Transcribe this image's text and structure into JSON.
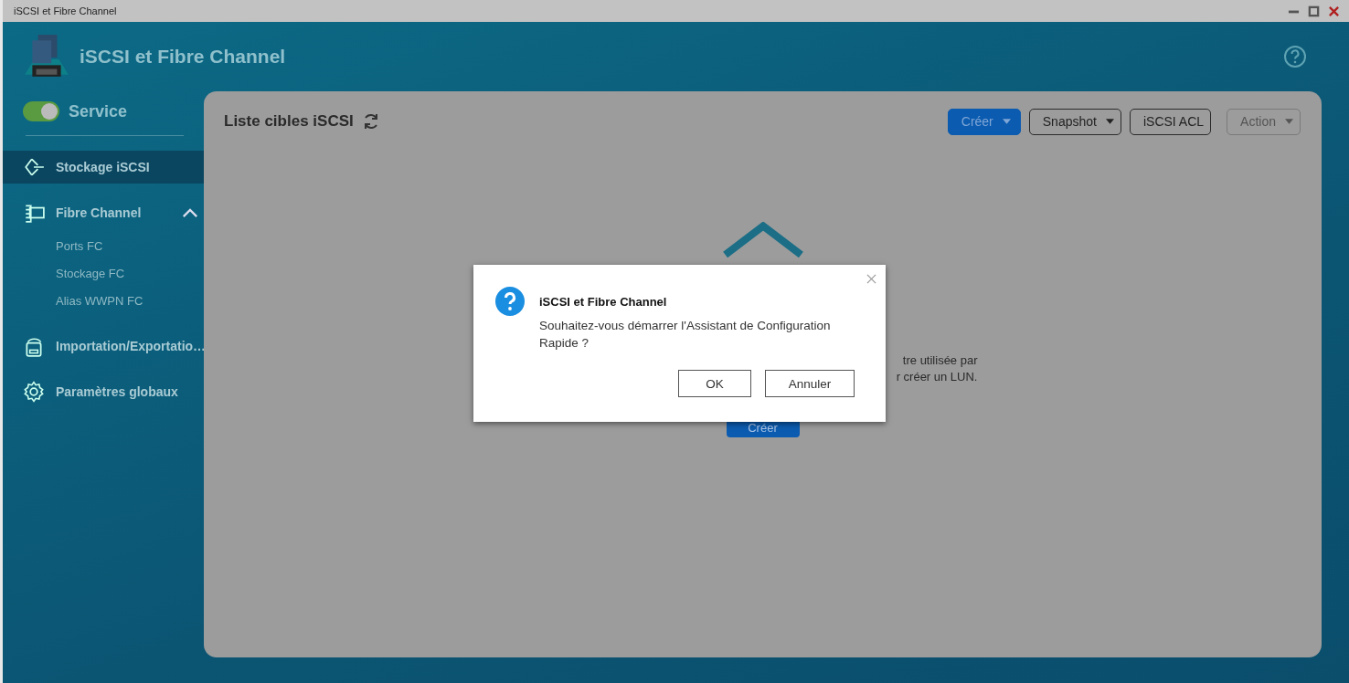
{
  "window": {
    "title": "iSCSI et Fibre Channel"
  },
  "header": {
    "title": "iSCSI et Fibre Channel"
  },
  "service": {
    "label": "Service",
    "on": true
  },
  "sidebar": {
    "items": [
      {
        "label": "Stockage iSCSI",
        "kind": "diamond",
        "selected": true
      },
      {
        "label": "Fibre Channel",
        "kind": "fibre",
        "selected": false,
        "expanded": true,
        "children": [
          {
            "label": "Ports FC",
            "selected": false
          },
          {
            "label": "Stockage FC",
            "selected": false
          },
          {
            "label": "Alias WWPN FC",
            "selected": false
          }
        ]
      },
      {
        "label": "Importation/Exportatio…",
        "kind": "disk",
        "selected": false
      },
      {
        "label": "Paramètres globaux",
        "kind": "gear",
        "selected": false
      }
    ]
  },
  "panel": {
    "title": "Liste cibles iSCSI",
    "toolbar": [
      {
        "label": "Créer",
        "kind": "split",
        "disabled": false
      },
      {
        "label": "Snapshot",
        "kind": "dropdown",
        "disabled": false
      },
      {
        "label": "iSCSI ACL",
        "kind": "plain",
        "disabled": false
      },
      {
        "label": "Action",
        "kind": "dropdown",
        "disabled": true
      }
    ],
    "empty_state": {
      "lines": [
        "tre utilisée par",
        "r créer un LUN."
      ],
      "button": "Créer"
    }
  },
  "dialog": {
    "title": "iSCSI et Fibre Channel",
    "message": "Souhaitez-vous démarrer l'Assistant de Configuration Rapide ?",
    "buttons": [
      "OK",
      "Annuler"
    ]
  }
}
